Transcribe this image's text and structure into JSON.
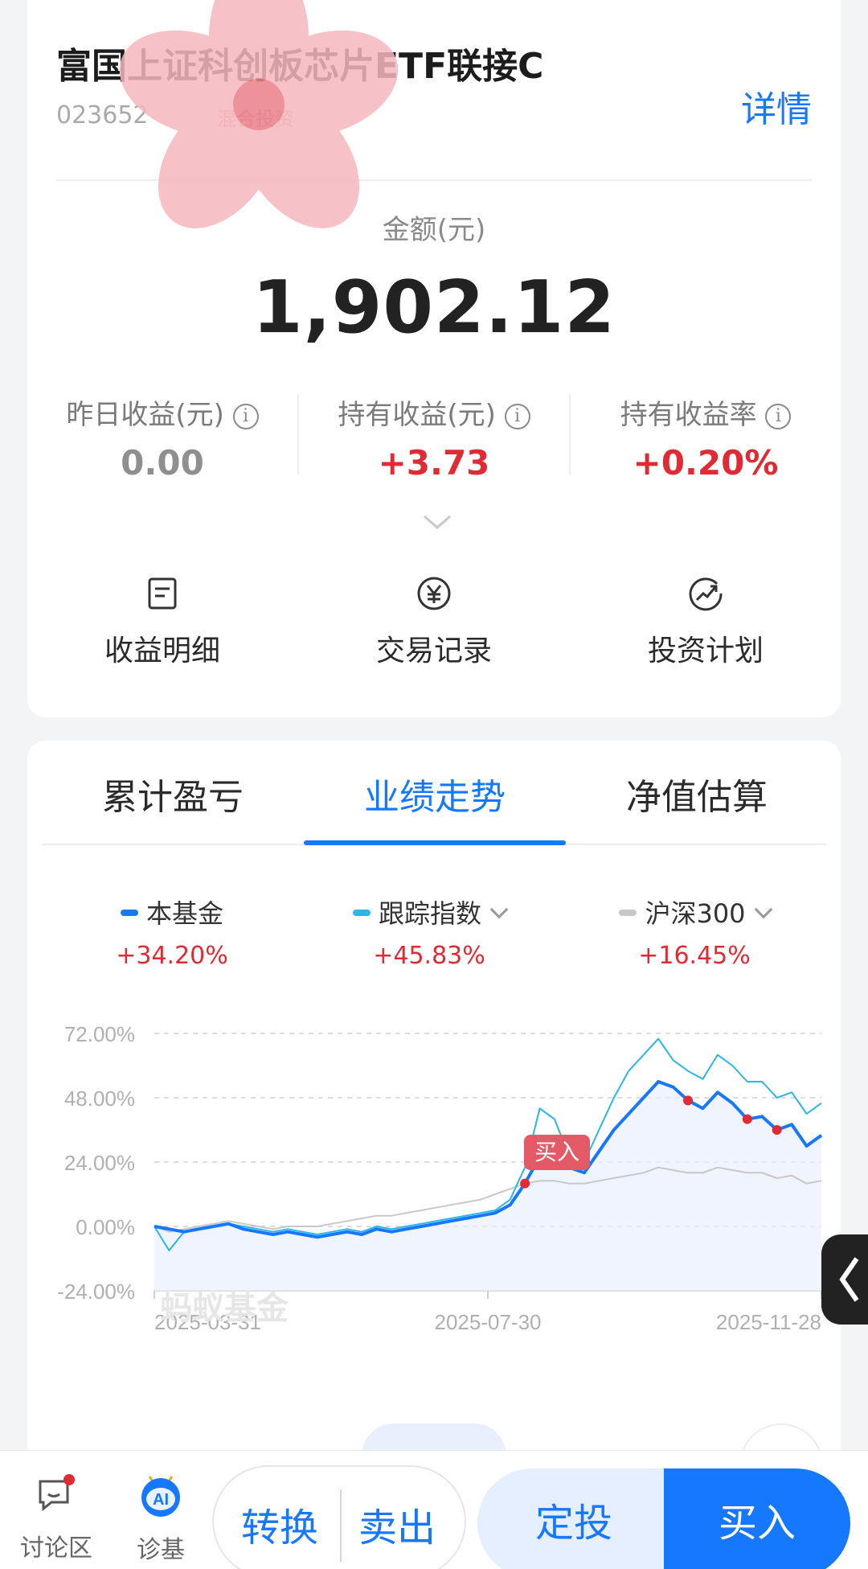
{
  "fund": {
    "title": "富国上证科创板芯片ETF联接C",
    "code": "023652",
    "tag": "混合投资",
    "detail_link": "详情"
  },
  "amount": {
    "label": "金额(元)",
    "value": "1,902.12"
  },
  "stats": [
    {
      "label": "昨日收益(元)",
      "value": "0.00"
    },
    {
      "label": "持有收益(元)",
      "value": "+3.73"
    },
    {
      "label": "持有收益率",
      "value": "+0.20%"
    }
  ],
  "info_glyph": "i",
  "actions": [
    {
      "label": "收益明细",
      "icon": "document-icon"
    },
    {
      "label": "交易记录",
      "icon": "yuan-circle-icon"
    },
    {
      "label": "投资计划",
      "icon": "trend-circle-icon"
    }
  ],
  "tabs": [
    "累计盈亏",
    "业绩走势",
    "净值估算"
  ],
  "active_tab": 1,
  "legend": [
    {
      "name": "本基金",
      "pct": "+34.20%",
      "color": "#1677ff"
    },
    {
      "name": "跟踪指数",
      "pct": "+45.83%",
      "color": "#2ab6e8"
    },
    {
      "name": "沪深300",
      "pct": "+16.45%",
      "color": "#c8c8c8"
    }
  ],
  "watermark": "蚂蚁基金",
  "buy_callout": "买入",
  "chart_data": {
    "type": "line",
    "x_ticks": [
      "2025-03-31",
      "2025-07-30",
      "2025-11-28"
    ],
    "y_ticks": [
      "72.00%",
      "48.00%",
      "24.00%",
      "0.00%",
      "-24.00%"
    ],
    "ylim": [
      -24,
      72
    ],
    "series": [
      {
        "name": "本基金",
        "color": "#1677ff",
        "values": [
          0,
          -1,
          -2,
          -1,
          0,
          1,
          -1,
          -2,
          -3,
          -2,
          -3,
          -4,
          -3,
          -2,
          -3,
          -1,
          -2,
          -1,
          0,
          1,
          2,
          3,
          4,
          5,
          8,
          16,
          26,
          32,
          22,
          20,
          28,
          36,
          42,
          48,
          54,
          52,
          47,
          44,
          50,
          46,
          40,
          41,
          36,
          38,
          30,
          34
        ]
      },
      {
        "name": "跟踪指数",
        "color": "#2ab6e8",
        "values": [
          0,
          -9,
          -2,
          -1,
          0,
          1,
          0,
          -1,
          -2,
          -1,
          -2,
          -3,
          -2,
          -1,
          -2,
          0,
          -1,
          0,
          1,
          2,
          3,
          4,
          5,
          6,
          10,
          22,
          44,
          40,
          26,
          24,
          36,
          48,
          58,
          64,
          70,
          62,
          58,
          55,
          64,
          60,
          54,
          54,
          48,
          50,
          42,
          46
        ]
      },
      {
        "name": "沪深300",
        "color": "#c8c8c8",
        "values": [
          0,
          -2,
          -1,
          0,
          1,
          2,
          1,
          0,
          -1,
          0,
          0,
          0,
          1,
          2,
          3,
          4,
          4,
          5,
          6,
          7,
          8,
          9,
          10,
          12,
          14,
          16,
          17,
          17,
          16,
          16,
          17,
          18,
          19,
          20,
          22,
          21,
          20,
          20,
          22,
          21,
          20,
          20,
          18,
          19,
          16,
          17
        ]
      }
    ],
    "markers": [
      {
        "series": 0,
        "index": 25
      },
      {
        "series": 0,
        "index": 26
      },
      {
        "series": 0,
        "index": 36
      },
      {
        "series": 0,
        "index": 40
      },
      {
        "series": 0,
        "index": 42
      }
    ]
  },
  "bottom_bar": {
    "discussion": "讨论区",
    "diagnose": "诊基",
    "ai_badge": "AI",
    "switch": "转换",
    "sell": "卖出",
    "plan": "定投",
    "buy": "买入"
  }
}
